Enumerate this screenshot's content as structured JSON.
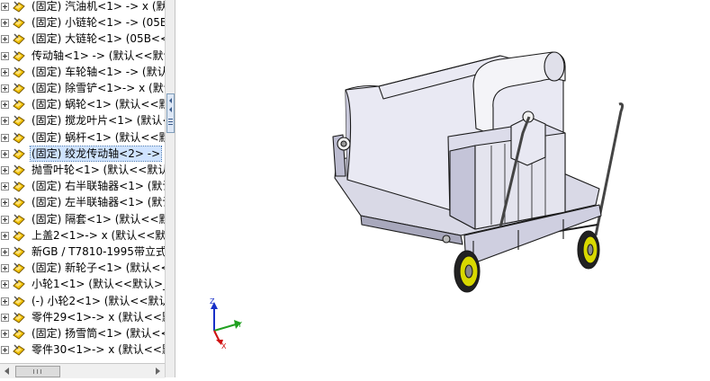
{
  "feature_tree": {
    "items": [
      {
        "label": "(固定) 汽油机<1> -> x (默认",
        "selected": false
      },
      {
        "label": "(固定) 小链轮<1> -> (05B",
        "selected": false
      },
      {
        "label": "(固定) 大链轮<1> (05B<<",
        "selected": false
      },
      {
        "label": "传动轴<1> -> (默认<<默认",
        "selected": false
      },
      {
        "label": "(固定) 车轮轴<1> -> (默认",
        "selected": false
      },
      {
        "label": "(固定) 除雪铲<1>-> x (默认",
        "selected": false
      },
      {
        "label": "(固定) 蜗轮<1> (默认<<默认",
        "selected": false
      },
      {
        "label": "(固定) 搅龙叶片<1> (默认<<",
        "selected": false
      },
      {
        "label": "(固定) 蜗杆<1> (默认<<默认",
        "selected": false
      },
      {
        "label": "(固定) 绞龙传动轴<2> ->",
        "selected": true
      },
      {
        "label": "抛雪叶轮<1> (默认<<默认>",
        "selected": false
      },
      {
        "label": "(固定) 右半联轴器<1> (默认",
        "selected": false
      },
      {
        "label": "(固定) 左半联轴器<1> (默认",
        "selected": false
      },
      {
        "label": "(固定) 隔套<1> (默认<<默",
        "selected": false
      },
      {
        "label": "上盖2<1>-> x (默认<<默认",
        "selected": false
      },
      {
        "label": "新GB / T7810-1995带立式",
        "selected": false
      },
      {
        "label": "(固定) 新轮子<1> (默认<<",
        "selected": false
      },
      {
        "label": "小轮1<1> (默认<<默认>_",
        "selected": false
      },
      {
        "label": "(-) 小轮2<1> (默认<<默认",
        "selected": false
      },
      {
        "label": "零件29<1>-> x (默认<<默",
        "selected": false
      },
      {
        "label": "(固定) 扬雪筒<1> (默认<<",
        "selected": false
      },
      {
        "label": "零件30<1>-> x (默认<<默",
        "selected": false
      }
    ],
    "icon": "component-part-icon"
  },
  "triad": {
    "x_label": "X",
    "y_label": "Y",
    "z_label": "Z"
  },
  "colors": {
    "selection_bg": "#cfe3ff",
    "triad_x": "#d01010",
    "triad_y": "#20a020",
    "triad_z": "#1830c8",
    "model_body": "#e6e6f0",
    "wheel_rim": "#d8d800"
  }
}
